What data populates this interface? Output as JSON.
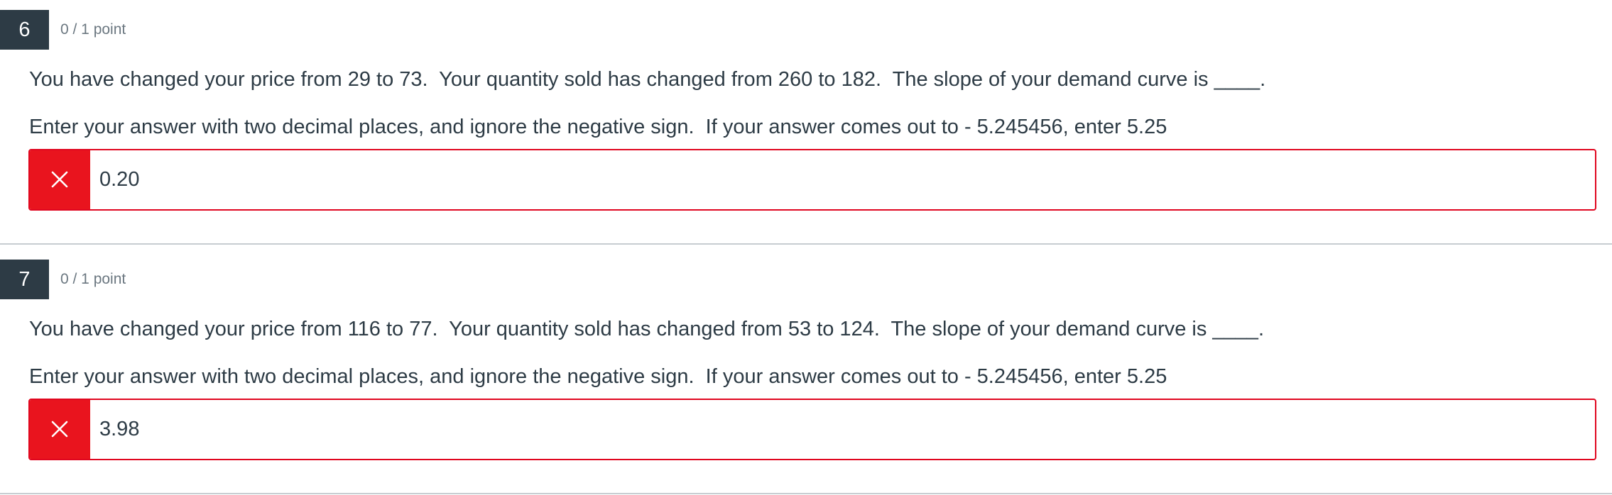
{
  "questions": [
    {
      "number": "6",
      "points": "0 / 1 point",
      "text": "You have changed your price from 29 to 73.  Your quantity sold has changed from 260 to 182.  The slope of your demand curve is ____.",
      "instruction": "Enter your answer with two decimal places, and ignore the negative sign.  If your answer comes out to - 5.245456, enter 5.25",
      "answer": "0.20",
      "status": "incorrect",
      "status_icon": "x-icon"
    },
    {
      "number": "7",
      "points": "0 / 1 point",
      "text": "You have changed your price from 116 to 77.  Your quantity sold has changed from 53 to 124.  The slope of your demand curve is ____.",
      "instruction": "Enter your answer with two decimal places, and ignore the negative sign.  If your answer comes out to - 5.245456, enter 5.25",
      "answer": "3.98",
      "status": "incorrect",
      "status_icon": "x-icon"
    }
  ],
  "colors": {
    "number_badge": "#2d3b45",
    "incorrect": "#e9141e",
    "text": "#2d3b45",
    "muted": "#6b7780",
    "divider": "#c7cdd1"
  }
}
